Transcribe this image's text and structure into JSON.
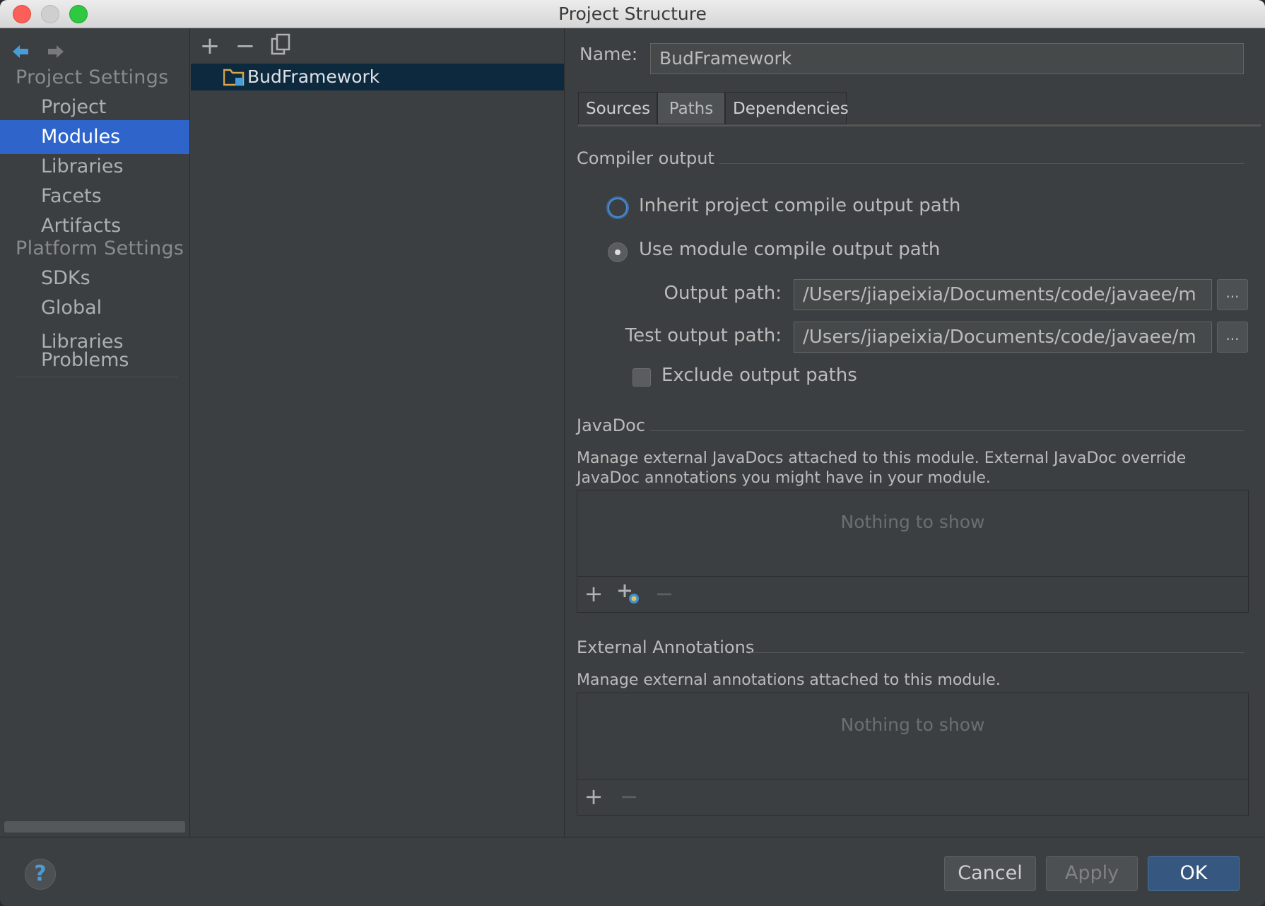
{
  "window": {
    "title": "Project Structure"
  },
  "sidebar": {
    "project_settings_label": "Project Settings",
    "platform_settings_label": "Platform Settings",
    "items": [
      {
        "label": "Project"
      },
      {
        "label": "Modules",
        "selected": true
      },
      {
        "label": "Libraries"
      },
      {
        "label": "Facets"
      },
      {
        "label": "Artifacts"
      },
      {
        "label": "SDKs"
      },
      {
        "label": "Global Libraries"
      },
      {
        "label": "Problems"
      }
    ]
  },
  "tree": {
    "toolbar": [
      "add-icon",
      "remove-icon",
      "copy-icon"
    ],
    "selected_module": "BudFramework"
  },
  "module": {
    "name_label": "Name:",
    "name_value": "BudFramework",
    "tabs": [
      {
        "label": "Sources"
      },
      {
        "label": "Paths",
        "active": true
      },
      {
        "label": "Dependencies"
      }
    ]
  },
  "compiler_output": {
    "title": "Compiler output",
    "inherit_label": "Inherit project compile output path",
    "use_module_label": "Use module compile output path",
    "output_path_label": "Output path:",
    "output_path_value": "/Users/jiapeixia/Documents/code/javaee/m",
    "test_output_path_label": "Test output path:",
    "test_output_path_value": "/Users/jiapeixia/Documents/code/javaee/m",
    "browse_label": "...",
    "exclude_label": "Exclude output paths",
    "selected_option": "use_module",
    "exclude_checked": false
  },
  "javadoc": {
    "title": "JavaDoc",
    "description": "Manage external JavaDocs attached to this module. External JavaDoc override JavaDoc annotations you might have in your module.",
    "empty_text": "Nothing to show"
  },
  "external_annotations": {
    "title": "External Annotations",
    "description": "Manage external annotations attached to this module.",
    "empty_text": "Nothing to show"
  },
  "buttons": {
    "help": "?",
    "cancel": "Cancel",
    "apply": "Apply",
    "ok": "OK"
  },
  "colors": {
    "selection": "#2f65ca",
    "tree_selection": "#0d293e",
    "default_button": "#365880",
    "background": "#3c3f41"
  }
}
